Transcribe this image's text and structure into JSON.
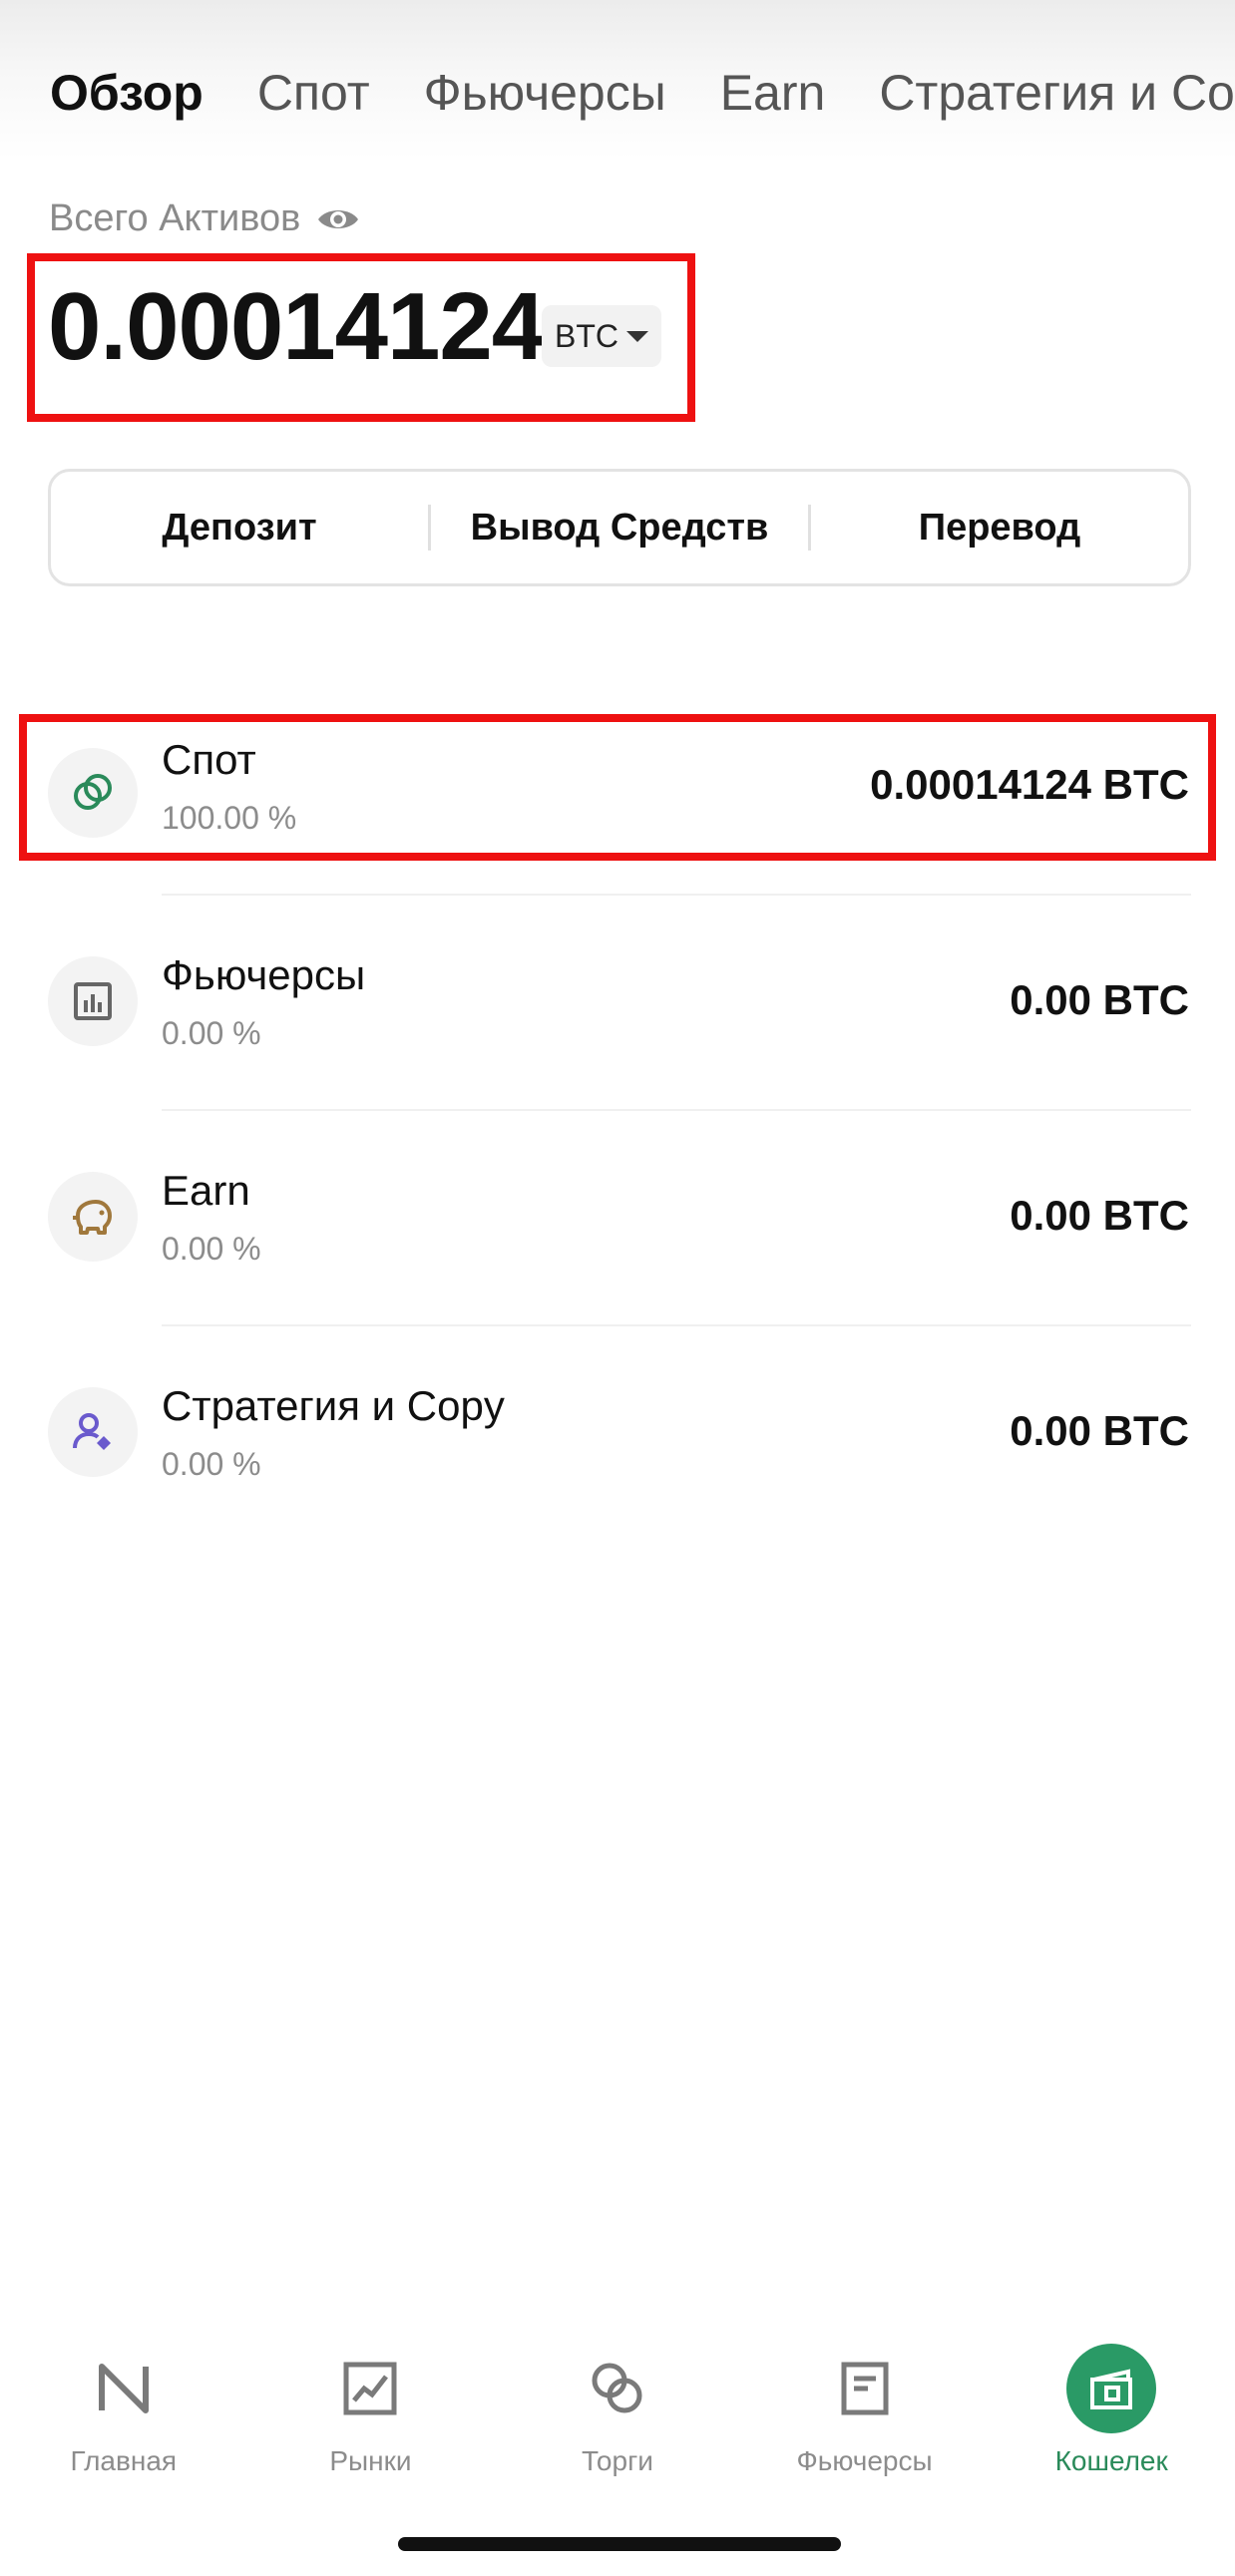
{
  "tabs": [
    {
      "label": "Обзор",
      "active": true
    },
    {
      "label": "Спот",
      "active": false
    },
    {
      "label": "Фьючерсы",
      "active": false
    },
    {
      "label": "Earn",
      "active": false
    },
    {
      "label": "Стратегия и Copy",
      "active": false
    }
  ],
  "overview": {
    "total_label": "Всего Активов",
    "total_value": "0.00014124",
    "currency": "BTC"
  },
  "actions": {
    "deposit": "Депозит",
    "withdraw": "Вывод Средств",
    "transfer": "Перевод"
  },
  "accounts": [
    {
      "name": "Спот",
      "percent": "100.00 %",
      "value": "0.00014124 BTC",
      "icon": "spot-coins-icon"
    },
    {
      "name": "Фьючерсы",
      "percent": "0.00 %",
      "value": "0.00 BTC",
      "icon": "futures-chart-icon"
    },
    {
      "name": "Earn",
      "percent": "0.00 %",
      "value": "0.00 BTC",
      "icon": "piggy-bank-icon"
    },
    {
      "name": "Стратегия и Copy",
      "percent": "0.00 %",
      "value": "0.00 BTC",
      "icon": "strategy-user-icon"
    }
  ],
  "bottom_nav": [
    {
      "label": "Главная",
      "icon": "home-logo-icon",
      "active": false
    },
    {
      "label": "Рынки",
      "icon": "markets-icon",
      "active": false
    },
    {
      "label": "Торги",
      "icon": "trade-icon",
      "active": false
    },
    {
      "label": "Фьючерсы",
      "icon": "futures-doc-icon",
      "active": false
    },
    {
      "label": "Кошелек",
      "icon": "wallet-icon",
      "active": true
    }
  ],
  "colors": {
    "accent": "#2a9a66",
    "highlight_box": "#ee1111"
  }
}
